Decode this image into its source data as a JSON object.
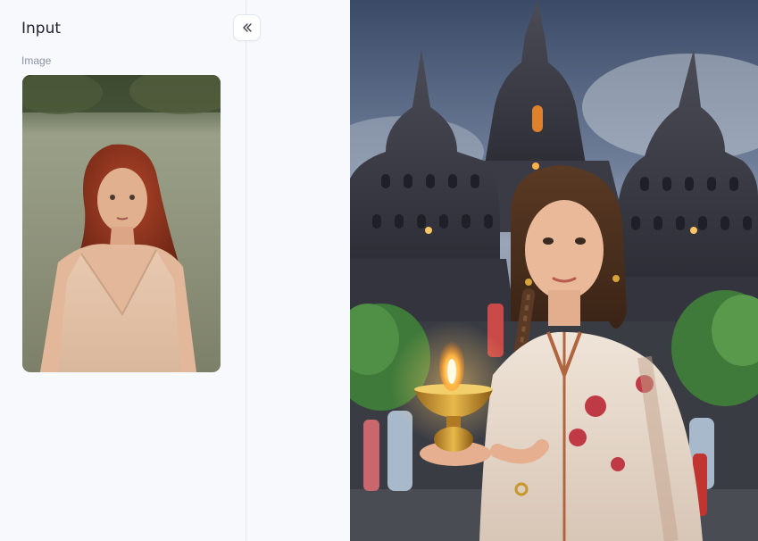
{
  "input_panel": {
    "title": "Input",
    "image_field_label": "Image",
    "collapse_icon": "double-chevron-left-icon"
  },
  "colors": {
    "panel_bg": "#f8f9fc",
    "border": "#e6e8ee",
    "title_text": "#1f2430",
    "label_text": "#8b93a1"
  }
}
